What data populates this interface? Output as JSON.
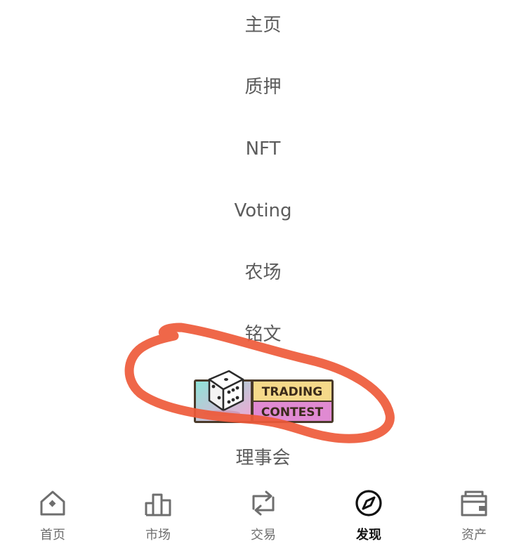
{
  "menu": {
    "items": [
      {
        "label": "主页"
      },
      {
        "label": "质押"
      },
      {
        "label": "NFT"
      },
      {
        "label": "Voting"
      },
      {
        "label": "农场"
      },
      {
        "label": "铭文"
      },
      {
        "label": "理事会"
      }
    ],
    "banner": {
      "line1": "TRADING",
      "line2": "CONTEST",
      "icon": "dice-icon"
    }
  },
  "annotation": {
    "color": "#ee5a3a",
    "shape": "hand-drawn-loop"
  },
  "tabbar": {
    "active_index": 3,
    "active_color": "#111111",
    "inactive_color": "#6e6e6e",
    "tabs": [
      {
        "label": "首页",
        "icon": "home-icon"
      },
      {
        "label": "市场",
        "icon": "chart-icon"
      },
      {
        "label": "交易",
        "icon": "swap-icon"
      },
      {
        "label": "发现",
        "icon": "compass-icon"
      },
      {
        "label": "资产",
        "icon": "wallet-icon"
      }
    ]
  }
}
